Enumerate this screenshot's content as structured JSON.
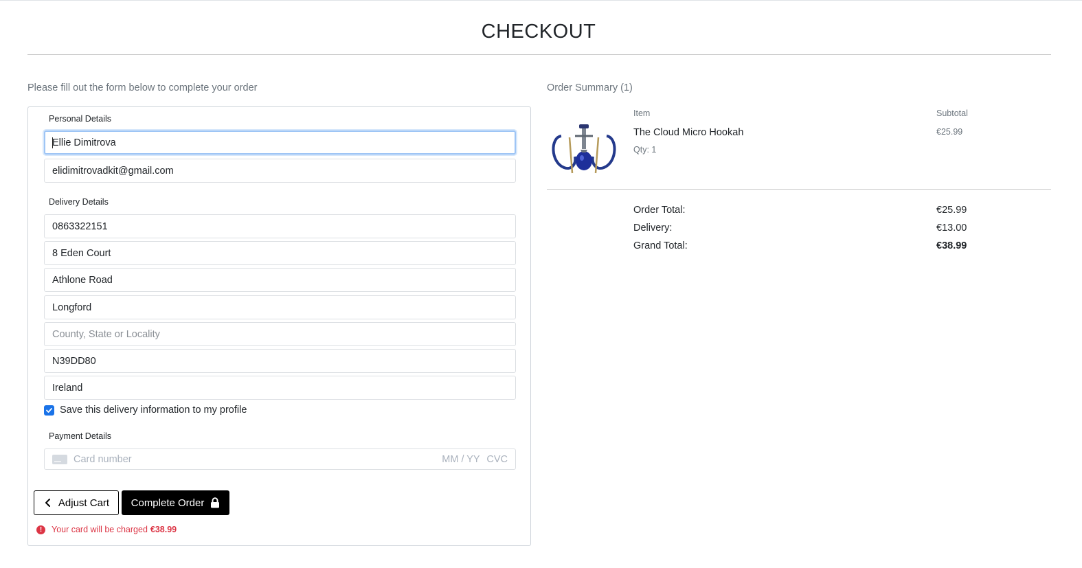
{
  "page": {
    "title": "CHECKOUT",
    "intro": "Please fill out the form below to complete your order"
  },
  "form": {
    "personal_legend": "Personal Details",
    "full_name": "Ellie Dimitrova",
    "email": "elidimitrovadkit@gmail.com",
    "delivery_legend": "Delivery Details",
    "phone": "0863322151",
    "street1": "8 Eden Court",
    "street2": "Athlone Road",
    "town": "Longford",
    "county_placeholder": "County, State or Locality",
    "postcode": "N39DD80",
    "country": "Ireland",
    "save_info_label": "Save this delivery information to my profile",
    "save_info_checked": true,
    "payment_legend": "Payment Details",
    "card_placeholder": "Card number",
    "expiry_placeholder": "MM / YY",
    "cvc_placeholder": "CVC",
    "adjust_cart_label": "Adjust Cart",
    "complete_order_label": "Complete Order",
    "charge_text": "Your card will be charged",
    "charge_amount": "€38.99"
  },
  "summary": {
    "title": "Order Summary (1)",
    "item_col": "Item",
    "subtotal_col": "Subtotal",
    "product": {
      "name": "The Cloud Micro Hookah",
      "qty": "Qty: 1",
      "subtotal": "€25.99"
    },
    "order_total_label": "Order Total:",
    "order_total": "€25.99",
    "delivery_label": "Delivery:",
    "delivery": "€13.00",
    "grand_total_label": "Grand Total:",
    "grand_total": "€38.99"
  },
  "colors": {
    "accent": "#1a73e8",
    "danger": "#dc3545",
    "primary_button": "#000000"
  }
}
